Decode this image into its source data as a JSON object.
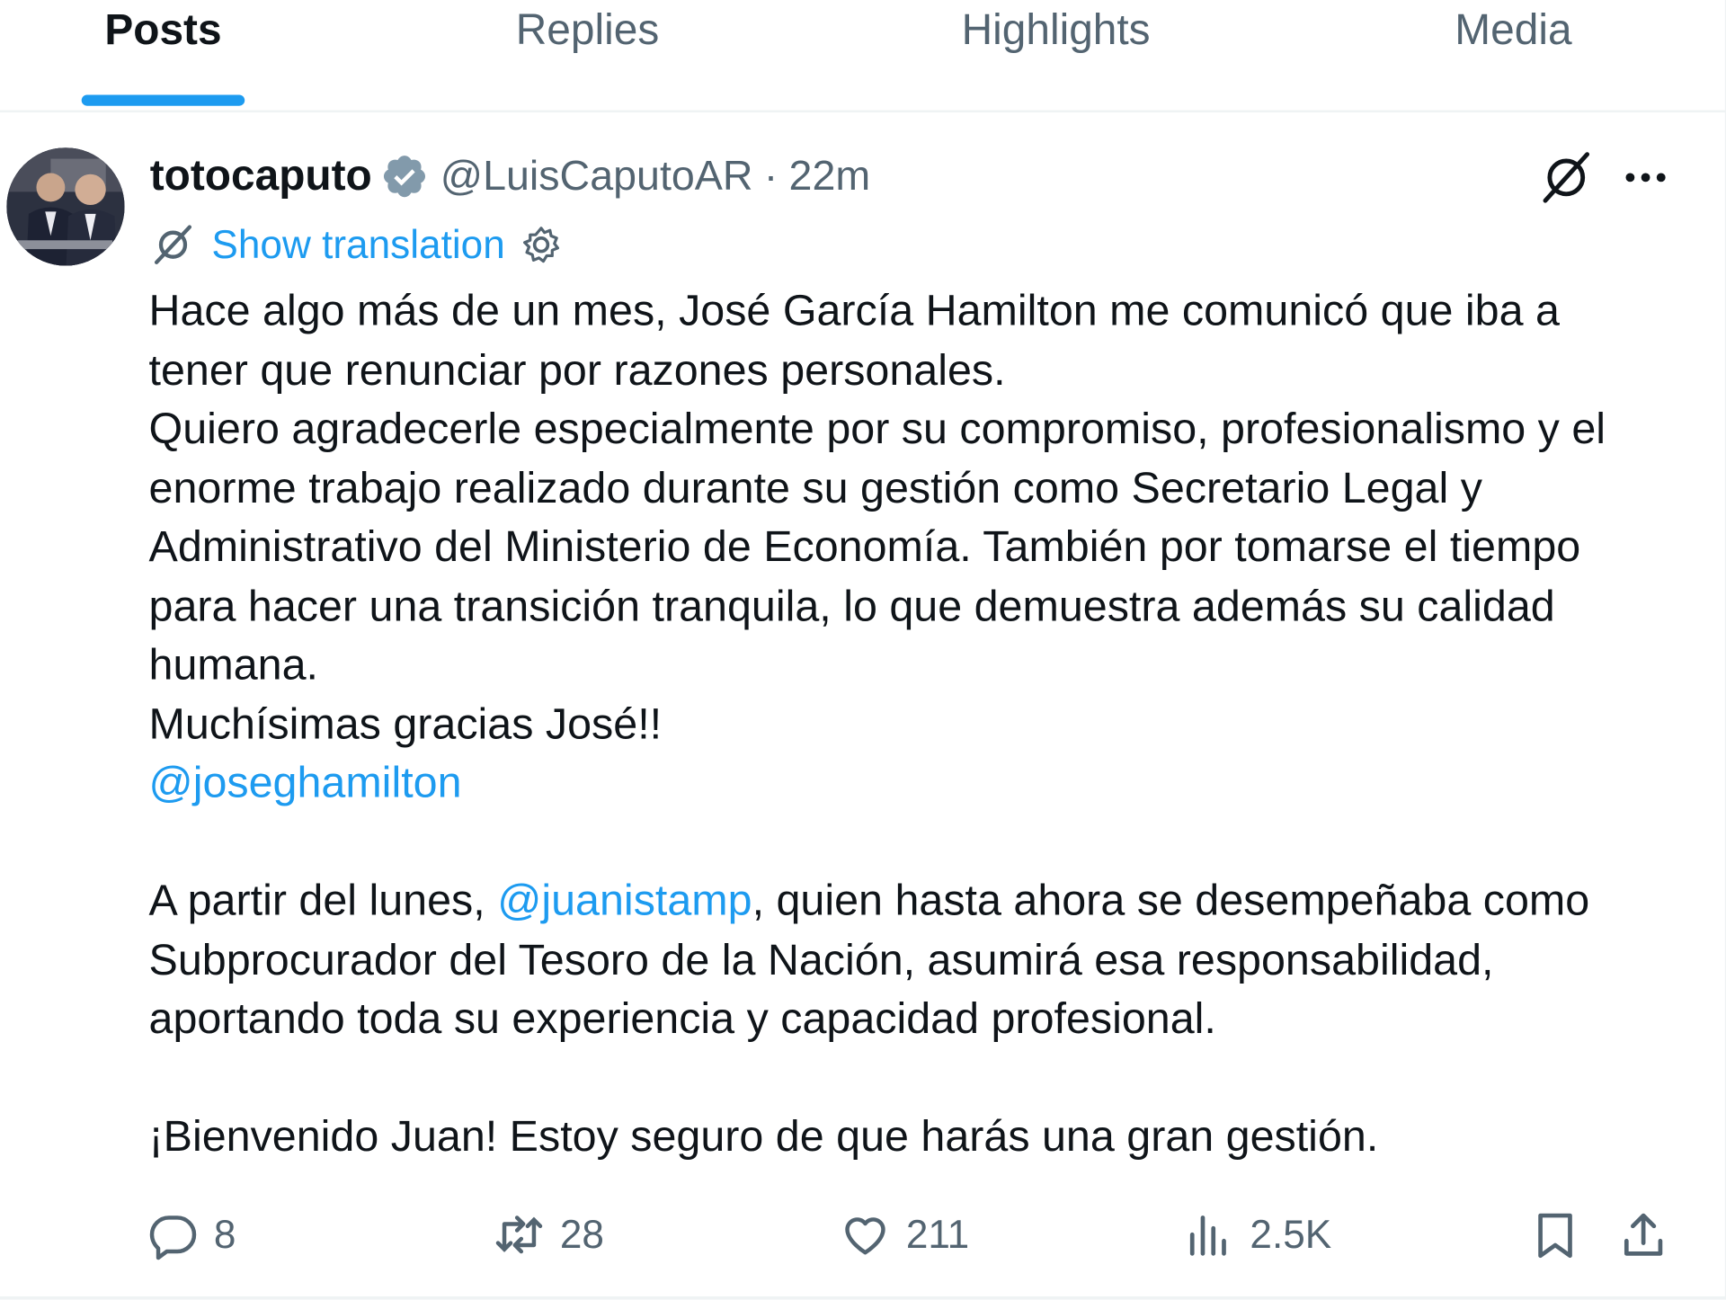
{
  "tabs": [
    "Posts",
    "Replies",
    "Highlights",
    "Media"
  ],
  "post": {
    "display_name": "totocaputo",
    "handle": "@LuisCaputoAR",
    "separator": "·",
    "time": "22m",
    "show_translation": "Show translation",
    "text": {
      "p1": [
        "Hace algo más de un mes, José García Hamilton me comunicó que iba a",
        "tener que renunciar por razones personales."
      ],
      "p2": [
        "Quiero agradecerle especialmente por su compromiso, profesionalismo y el",
        "enorme trabajo realizado durante su gestión como Secretario Legal y",
        "Administrativo del Ministerio de Economía. También por tomarse el tiempo",
        "para hacer una transición tranquila, lo que demuestra además su calidad",
        "humana."
      ],
      "p3": "Muchísimas gracias José!!",
      "mention1": "@joseghamilton",
      "p4_before": "A partir del lunes, ",
      "mention2": "@juanistamp",
      "p4_after": ", quien hasta ahora se desempeñaba como",
      "p4_lines": [
        "Subprocurador del Tesoro de la Nación, asumirá esa responsabilidad,",
        "aportando toda su experiencia y capacidad profesional."
      ],
      "p5": "¡Bienvenido Juan! Estoy seguro de que harás una gran gestión."
    },
    "stats": {
      "replies": "8",
      "reposts": "28",
      "likes": "211",
      "views": "2.5K"
    }
  },
  "colors": {
    "accent": "#1d9bf0",
    "text": "#0f1419",
    "muted": "#536471",
    "border": "#eff3f4"
  },
  "icons": [
    "verified-badge-icon",
    "grok-icon",
    "more-icon",
    "translate-icon",
    "settings-icon",
    "reply-icon",
    "repost-icon",
    "like-icon",
    "views-icon",
    "bookmark-icon",
    "share-icon"
  ]
}
